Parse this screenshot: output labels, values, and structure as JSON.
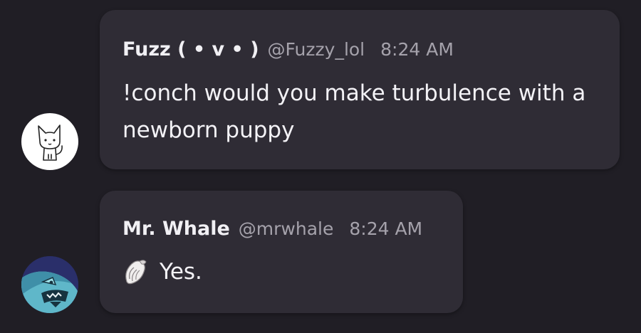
{
  "messages": [
    {
      "author": "Fuzz ( • v • )",
      "handle": "@Fuzzy_lol",
      "time": "8:24 AM",
      "text": "!conch would you make turbulence with a newborn puppy",
      "avatar": "white-cat-avatar"
    },
    {
      "author": "Mr. Whale",
      "handle": "@mrwhale",
      "time": "8:24 AM",
      "emoji": "spiral-shell-icon",
      "text": "Yes.",
      "avatar": "blue-whale-avatar"
    }
  ],
  "colors": {
    "background": "#201e25",
    "bubble": "#2f2c35",
    "name": "#f1f0f4",
    "muted": "#a5a2ab",
    "text": "#f3f2f6"
  }
}
